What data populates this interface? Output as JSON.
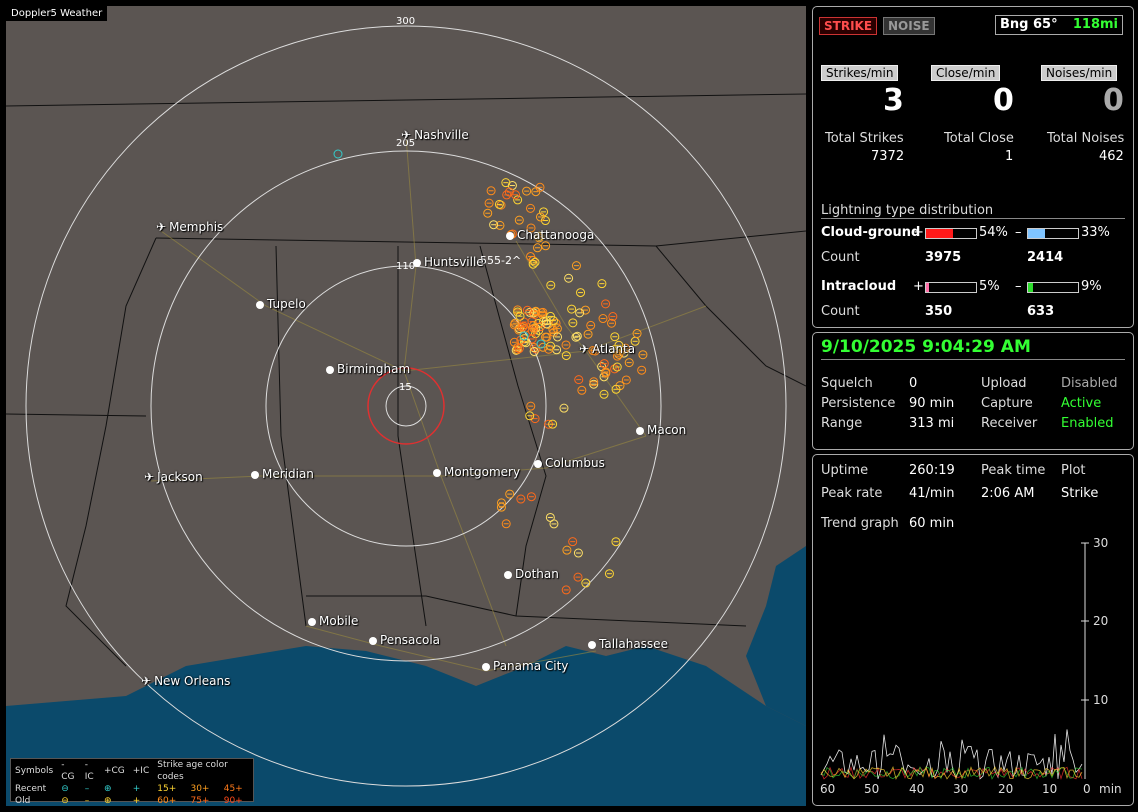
{
  "app": {
    "title": "Doppler5 Weather"
  },
  "map": {
    "ring_labels": [
      "300",
      "205",
      "110",
      "15"
    ],
    "cities": [
      {
        "name": "Nashville",
        "icon": "plane"
      },
      {
        "name": "Memphis",
        "icon": "plane"
      },
      {
        "name": "Chattanooga",
        "icon": "dot"
      },
      {
        "name": "Huntsville",
        "icon": "dot"
      },
      {
        "name": "Tupelo",
        "icon": "dot"
      },
      {
        "name": "Birmingham",
        "icon": "dot"
      },
      {
        "name": "Atlanta",
        "icon": "plane"
      },
      {
        "name": "Macon",
        "icon": "dot"
      },
      {
        "name": "Jackson",
        "icon": "plane"
      },
      {
        "name": "Meridian",
        "icon": "dot"
      },
      {
        "name": "Montgomery",
        "icon": "dot"
      },
      {
        "name": "Columbus",
        "icon": "dot"
      },
      {
        "name": "Dothan",
        "icon": "dot"
      },
      {
        "name": "Mobile",
        "icon": "dot"
      },
      {
        "name": "Pensacola",
        "icon": "dot"
      },
      {
        "name": "Tallahassee",
        "icon": "dot"
      },
      {
        "name": "Panama City",
        "icon": "dot"
      },
      {
        "name": "New Orleans",
        "icon": "plane"
      }
    ],
    "map_annotation": "555-2^",
    "legend": {
      "header": [
        "Symbols",
        "-CG",
        "-IC",
        "+CG",
        "+IC",
        "Strike age color codes"
      ],
      "recent": {
        "label": "Recent",
        "codes": [
          "15+",
          "30+",
          "45+"
        ]
      },
      "old": {
        "label": "Old",
        "codes": [
          "60+",
          "75+",
          "90+"
        ]
      }
    }
  },
  "stats": {
    "strike_btn": "STRIKE",
    "noise_btn": "NOISE",
    "bearing": "Bng 65°",
    "distance": "118mi",
    "strikes_min_label": "Strikes/min",
    "close_min_label": "Close/min",
    "noises_min_label": "Noises/min",
    "strikes_min": "3",
    "close_min": "0",
    "noises_min": "0",
    "total_strikes_label": "Total Strikes",
    "total_close_label": "Total Close",
    "total_noises_label": "Total Noises",
    "total_strikes": "7372",
    "total_close": "1",
    "total_noises": "462",
    "dist_title": "Lightning type distribution",
    "cg_label": "Cloud-ground",
    "ic_label": "Intracloud",
    "count_label": "Count",
    "cg_pos_pct": "54%",
    "cg_neg_pct": "33%",
    "cg_pos_count": "3975",
    "cg_neg_count": "2414",
    "ic_pos_pct": "5%",
    "ic_neg_pct": "9%",
    "ic_pos_count": "350",
    "ic_neg_count": "633",
    "plus": "+",
    "minus": "–",
    "bars": {
      "cg_pos": 0.54,
      "cg_neg": 0.33,
      "ic_pos": 0.05,
      "ic_neg": 0.09
    }
  },
  "status": {
    "datetime": "9/10/2025 9:04:29 AM",
    "squelch_label": "Squelch",
    "squelch": "0",
    "persistence_label": "Persistence",
    "persistence": "90 min",
    "range_label": "Range",
    "range": "313 mi",
    "upload_label": "Upload",
    "upload": "Disabled",
    "capture_label": "Capture",
    "capture": "Active",
    "receiver_label": "Receiver",
    "receiver": "Enabled"
  },
  "trend": {
    "uptime_label": "Uptime",
    "uptime": "260:19",
    "peak_time_label": "Peak time",
    "peak_time": "2:06 AM",
    "plot_label": "Plot",
    "plot": "Strike",
    "peak_rate_label": "Peak rate",
    "peak_rate": "41/min",
    "trend_label": "Trend graph",
    "trend": "60 min",
    "y_ticks": [
      "30",
      "20",
      "10"
    ],
    "x_ticks": [
      "60",
      "50",
      "40",
      "30",
      "20",
      "10",
      "0"
    ],
    "x_unit": "min"
  },
  "colors": {
    "accent_green": "#33ff33",
    "strike_red": "#ff4d4d",
    "map_land": "#5b5552",
    "map_water": "#0b4a6b",
    "strike_yellow": "#ffd633",
    "strike_orange": "#ff8c1a"
  }
}
